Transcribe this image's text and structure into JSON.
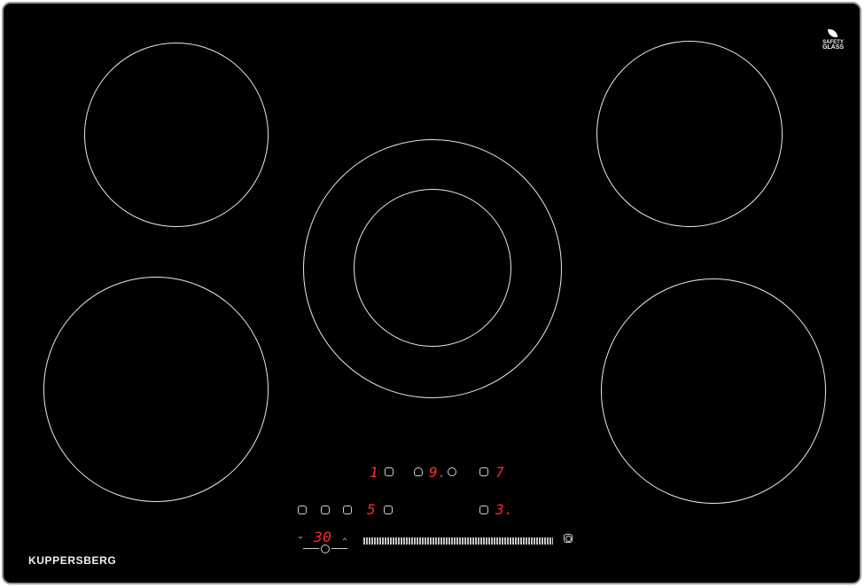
{
  "brand": "KUPPERSBERG",
  "safety_badge": {
    "line1": "SAFETY",
    "line2": "GLASS",
    "icon": "leaf-icon"
  },
  "controls": {
    "display_top_left": "1",
    "display_top_center": "9.",
    "display_top_right": "7",
    "display_bottom_left": "5",
    "display_bottom_right": "3.",
    "timer_value": "30",
    "timer_down_symbol": "‹",
    "timer_up_symbol": "›"
  },
  "colors": {
    "panel": "#000000",
    "display_red": "#ff2a2a",
    "ring": "#e9e9e9",
    "frame": "#9a9a9a"
  }
}
